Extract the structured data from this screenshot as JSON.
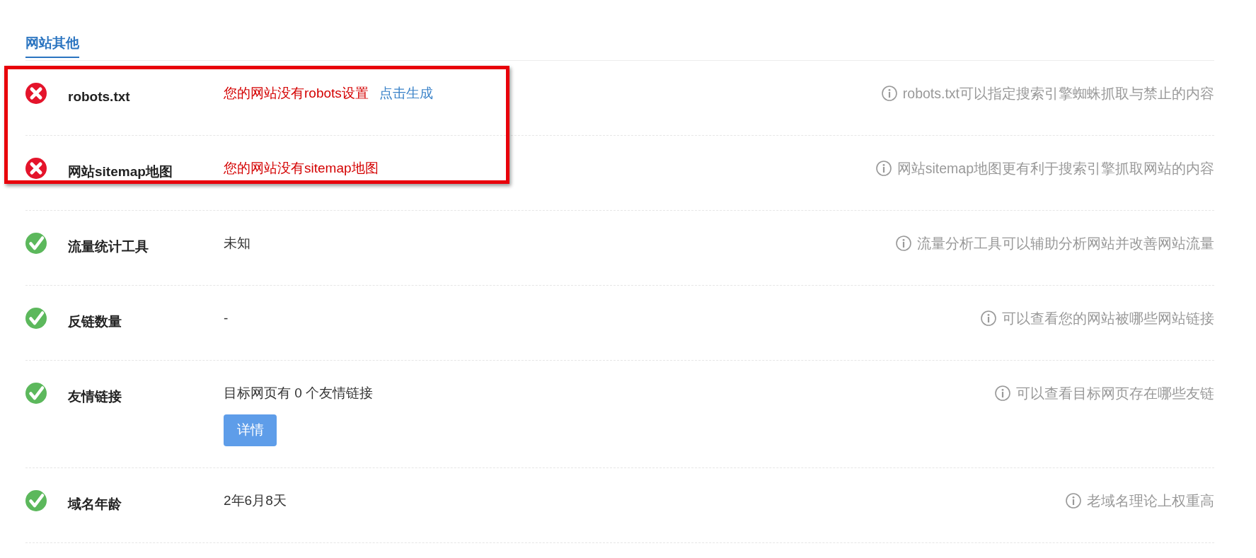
{
  "tabs": [
    {
      "label": "网站其他",
      "selected": true
    }
  ],
  "rows": [
    {
      "passed": false,
      "highlighted": true,
      "label": "robots.txt",
      "value": "您的网站没有robots设置",
      "link": "点击生成",
      "hint": "robots.txt可以指定搜索引擎蜘蛛抓取与禁止的内容"
    },
    {
      "passed": false,
      "highlighted": true,
      "label": "网站sitemap地图",
      "value": "您的网站没有sitemap地图",
      "hint": "网站sitemap地图更有利于搜索引擎抓取网站的内容"
    },
    {
      "passed": true,
      "highlighted": false,
      "label": "流量统计工具",
      "value": "未知",
      "hint": "流量分析工具可以辅助分析网站并改善网站流量"
    },
    {
      "passed": true,
      "highlighted": false,
      "label": "反链数量",
      "value": "-",
      "hint": "可以查看您的网站被哪些网站链接"
    },
    {
      "passed": true,
      "highlighted": false,
      "label": "友情链接",
      "value": "目标网页有 0 个友情链接",
      "button": "详情",
      "hint": "可以查看目标网页存在哪些友链"
    },
    {
      "passed": true,
      "highlighted": false,
      "label": "域名年龄",
      "value": "2年6月8天",
      "hint": "老域名理论上权重高"
    }
  ]
}
